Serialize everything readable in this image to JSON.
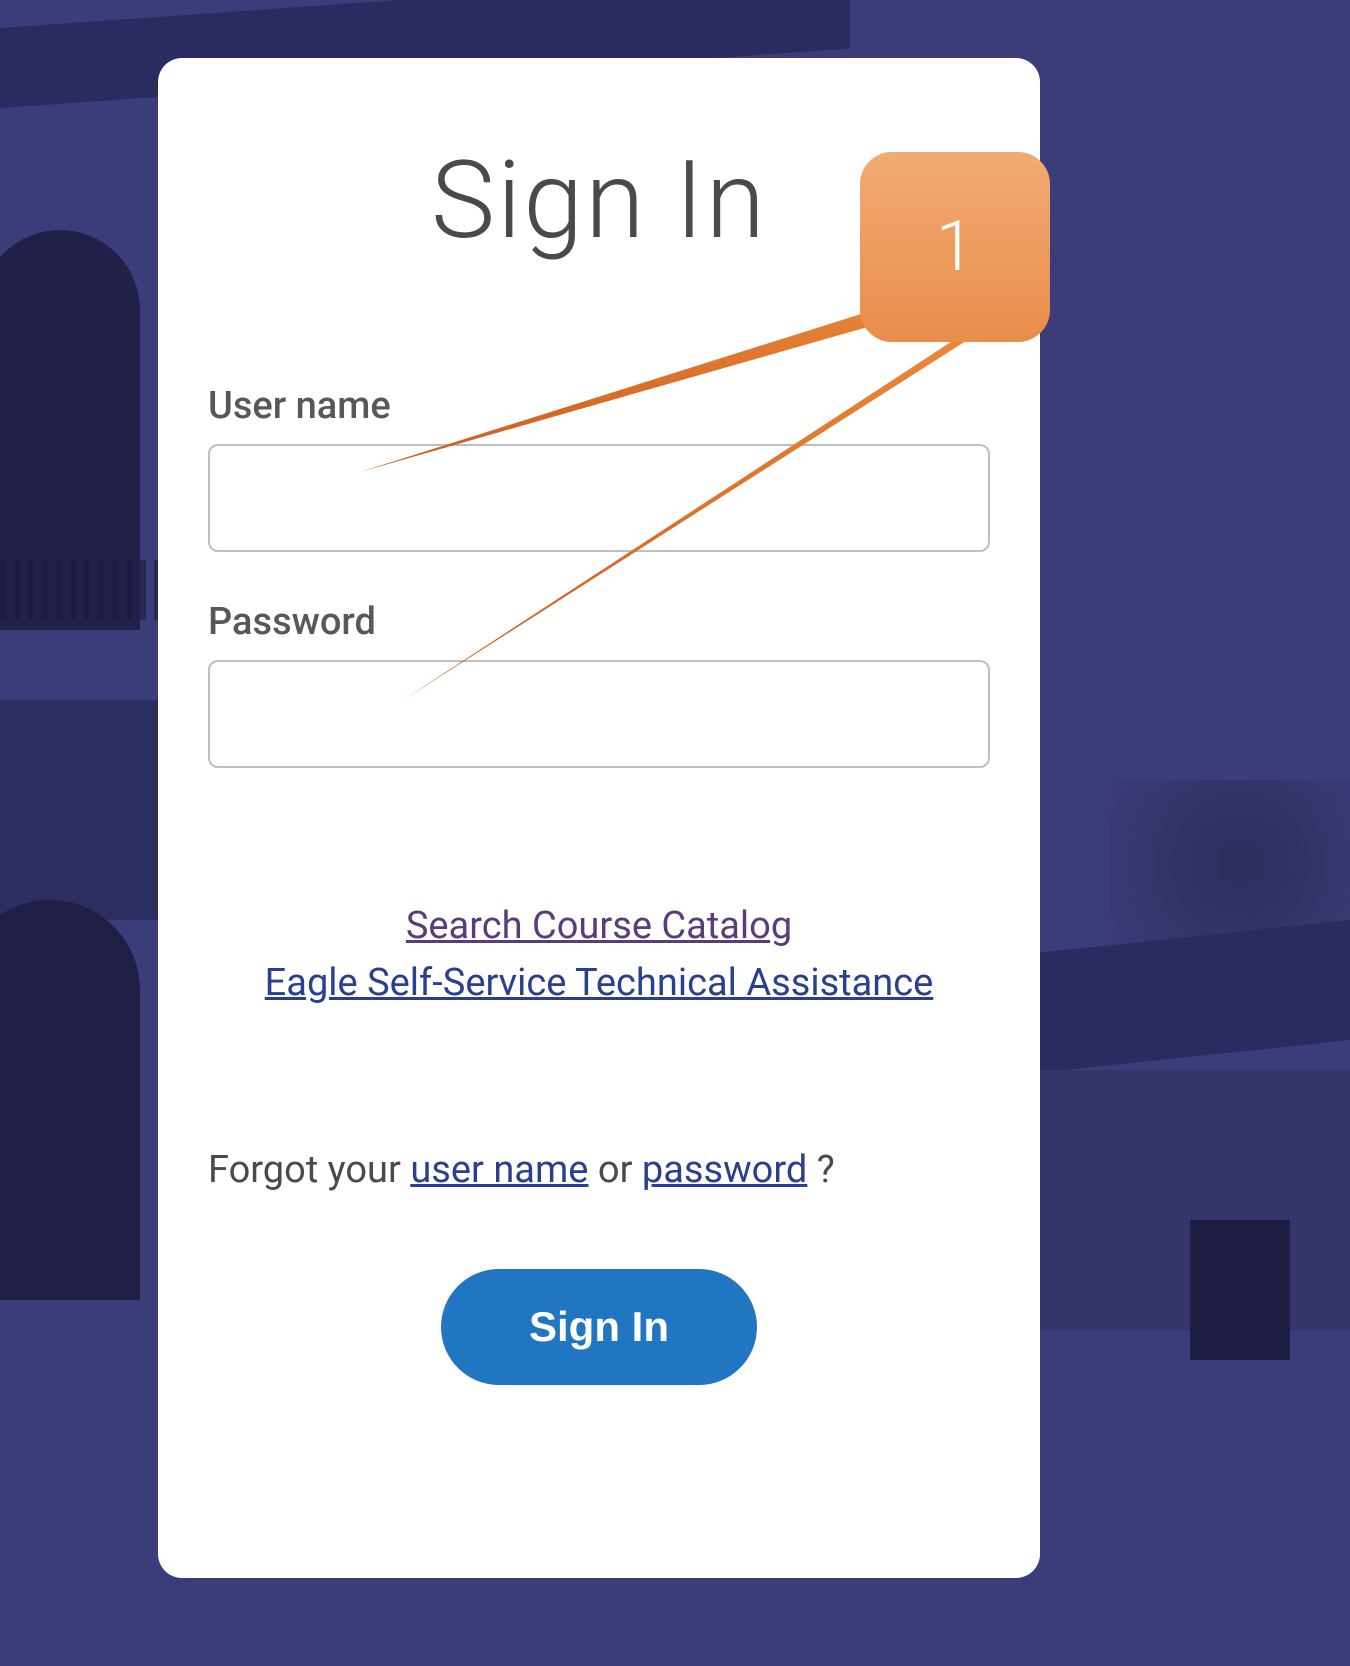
{
  "login": {
    "title": "Sign In",
    "username_label": "User name",
    "password_label": "Password",
    "username_value": "",
    "password_value": "",
    "links": {
      "catalog": "Search Course Catalog",
      "assistance": "Eagle Self-Service Technical Assistance"
    },
    "forgot": {
      "prefix": "Forgot your ",
      "username_link": "user name",
      "middle": " or ",
      "password_link": "password",
      "suffix": " ?"
    },
    "button_label": "Sign In"
  },
  "annotation": {
    "callout_number": "1"
  }
}
